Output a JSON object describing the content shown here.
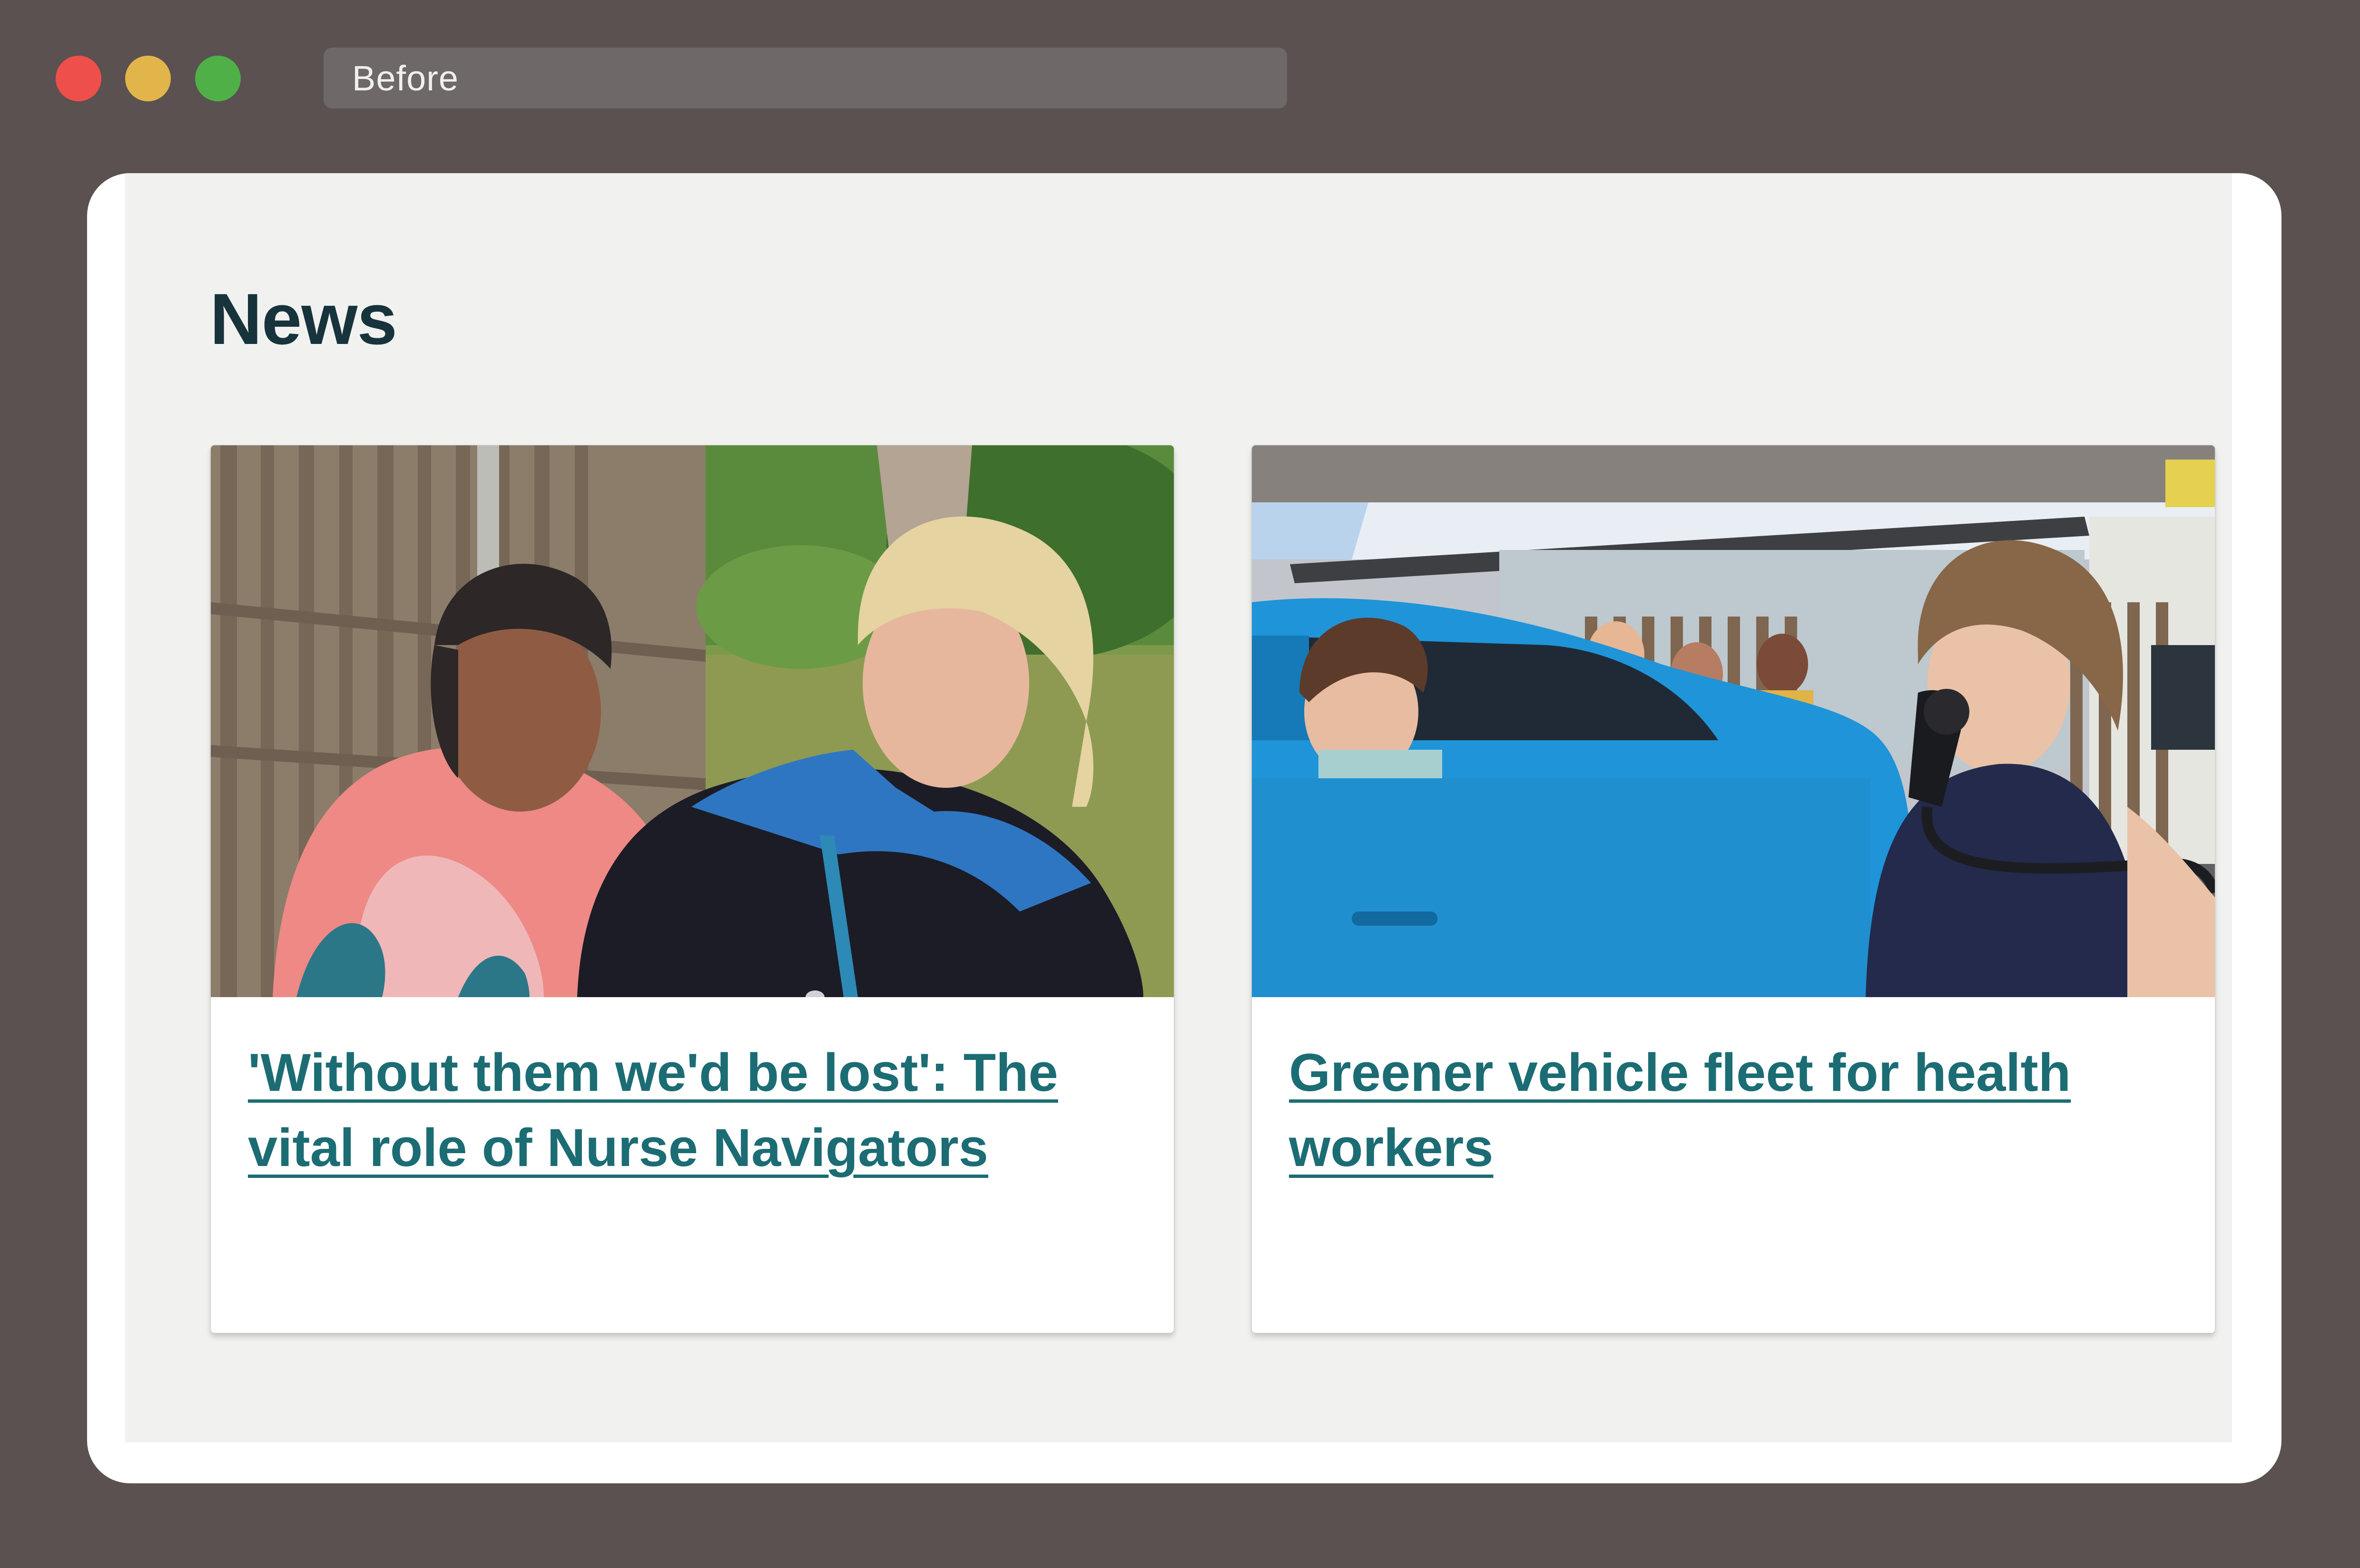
{
  "browser": {
    "address_text": "Before"
  },
  "page": {
    "title": "News"
  },
  "news": [
    {
      "title": "'Without them we'd be lost': The vital role of Nurse Navigators"
    },
    {
      "title": "Greener vehicle fleet for health workers"
    }
  ],
  "colors": {
    "background": "#5a5150",
    "page_background": "#f1f2ef",
    "title": "#17333c",
    "link": "#1c6c74",
    "dot_red": "#ef4f4a",
    "dot_yellow": "#e1b54a",
    "dot_green": "#4fb047"
  }
}
